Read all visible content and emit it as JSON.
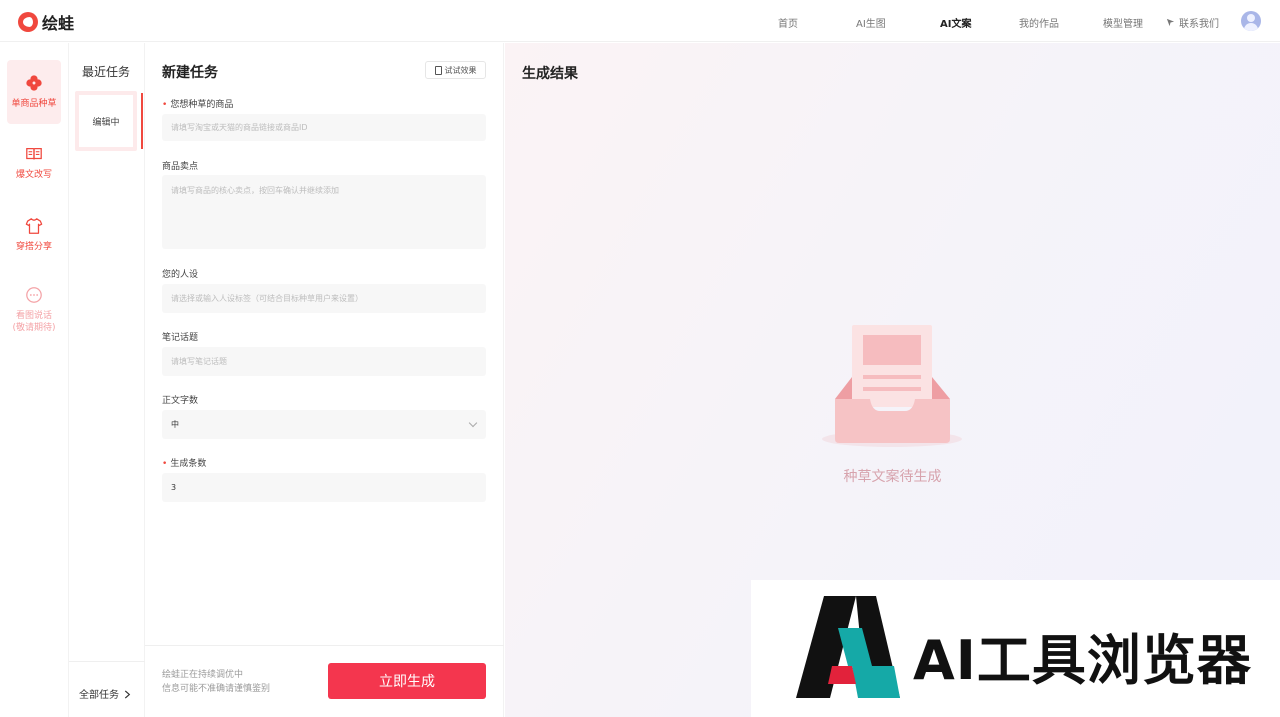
{
  "app": {
    "name": "绘蛙"
  },
  "nav": {
    "items": [
      "首页",
      "AI生图",
      "AI文案",
      "我的作品",
      "模型管理"
    ],
    "active": "AI文案",
    "contact": "联系我们"
  },
  "sidebar": {
    "items": [
      {
        "label": "单商品种草",
        "icon": "clover-icon",
        "active": true
      },
      {
        "label": "爆文改写",
        "icon": "book-icon"
      },
      {
        "label": "穿搭分享",
        "icon": "shirt-icon"
      },
      {
        "label": "看图说话",
        "sub": "(敬请期待)",
        "icon": "chat-bubble-icon",
        "disabled": true
      }
    ]
  },
  "recent": {
    "title": "最近任务",
    "card_label": "编辑中",
    "all_tasks": "全部任务"
  },
  "form": {
    "title": "新建任务",
    "try_label": "试试效果",
    "fields": {
      "product": {
        "label": "您想种草的商品",
        "required": true,
        "placeholder": "请填写淘宝或天猫的商品链接或商品ID"
      },
      "selling": {
        "label": "商品卖点",
        "placeholder": "请填写商品的核心卖点，按回车确认并继续添加"
      },
      "persona": {
        "label": "您的人设",
        "placeholder": "请选择或输入人设标签（可结合目标种草用户来设置）"
      },
      "topic": {
        "label": "笔记话题",
        "placeholder": "请填写笔记话题"
      },
      "length": {
        "label": "正文字数",
        "value": "中"
      },
      "count": {
        "label": "生成条数",
        "required": true,
        "value": "3"
      }
    },
    "notice": [
      "绘蛙正在持续调优中",
      "信息可能不准确请谨慎鉴别"
    ],
    "generate": "立即生成"
  },
  "result": {
    "title": "生成结果",
    "empty_text": "种草文案待生成"
  },
  "watermark": {
    "text": "AI工具浏览器"
  },
  "colors": {
    "accent": "#f4364e",
    "brand": "#f0483e"
  }
}
